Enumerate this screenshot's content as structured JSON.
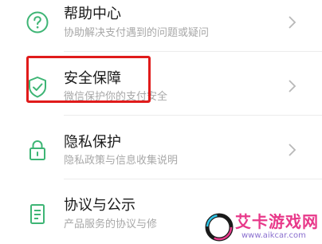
{
  "menu": {
    "items": [
      {
        "icon": "question-icon",
        "title": "帮助中心",
        "subtitle": "协助解决支付遇到的问题或疑问"
      },
      {
        "icon": "shield-check-icon",
        "title": "安全保障",
        "subtitle": "微信保护你的支付安全"
      },
      {
        "icon": "lock-icon",
        "title": "隐私保护",
        "subtitle": "隐私政策与信息收集说明"
      },
      {
        "icon": "document-icon",
        "title": "协议与公示",
        "subtitle": "产品服务的协议与修"
      }
    ]
  },
  "colors": {
    "icon_green": "#3eb575",
    "highlight_red": "#e01b1b",
    "title": "#1a1a1a",
    "subtitle": "#a8a8a8",
    "chevron": "#b8b8b8"
  },
  "watermark": {
    "brand": "艾卡游戏网",
    "url": "www.aikcar.com"
  }
}
